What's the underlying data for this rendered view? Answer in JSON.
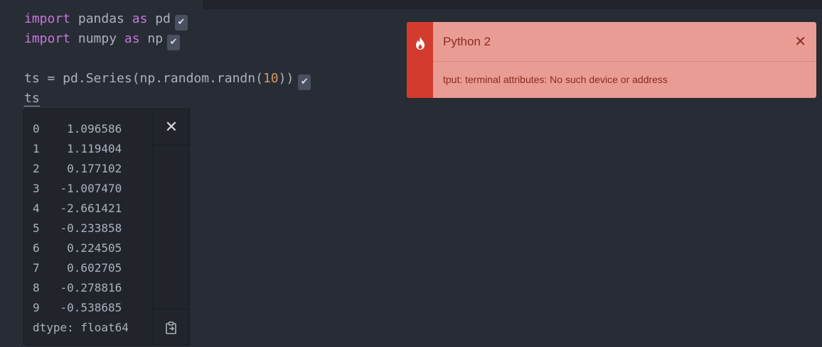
{
  "code": {
    "line1": {
      "kw1": "import",
      "mid": " pandas ",
      "kw2": "as",
      "end": " pd"
    },
    "line2": {
      "kw1": "import",
      "mid": " numpy ",
      "kw2": "as",
      "end": " np"
    },
    "line3": {
      "pre": "ts = pd.Series(np.random.randn(",
      "num": "10",
      "post": "))"
    },
    "line4": {
      "text": "ts"
    },
    "check_glyph": "✔"
  },
  "output": {
    "text": "0    1.096586\n1    1.119404\n2    0.177102\n3   -1.007470\n4   -2.661421\n5   -0.233858\n6    0.224505\n7    0.602705\n8   -0.278816\n9   -0.538685\ndtype: float64",
    "close_glyph": "✕"
  },
  "notification": {
    "title": "Python 2",
    "detail": "tput: terminal attributes: No such device or address",
    "close_glyph": "✕"
  },
  "colors": {
    "background": "#282c34",
    "keyword": "#c678dd",
    "number": "#d19a66",
    "error_strip": "#d43b2f",
    "error_body": "#e89c94"
  },
  "icons": {
    "notification": "flame-icon",
    "copy": "clipboard-icon"
  }
}
